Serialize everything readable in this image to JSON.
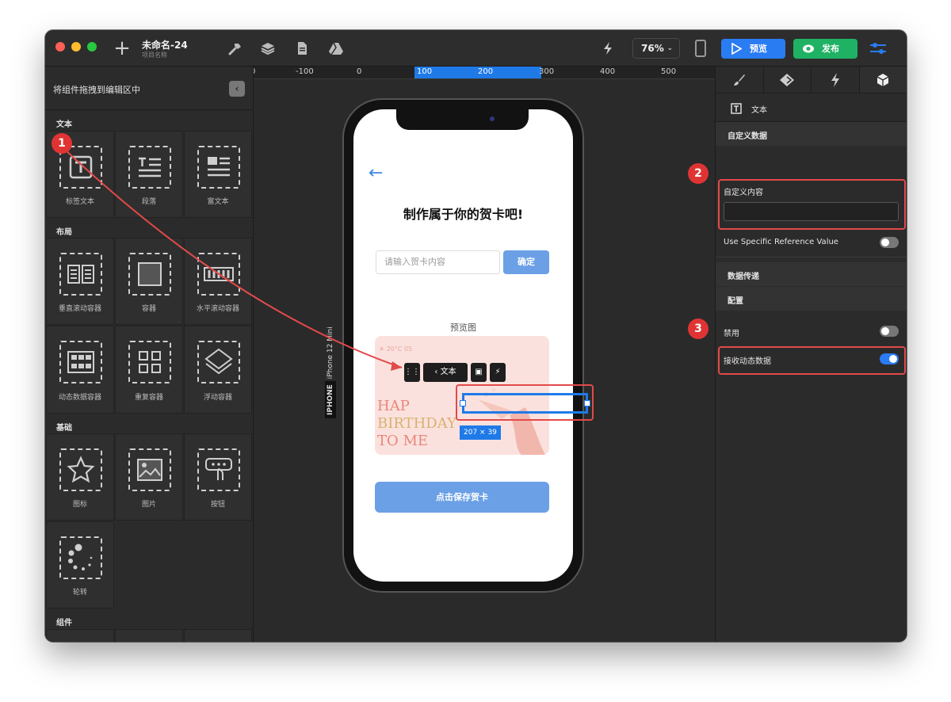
{
  "app": {
    "doc_title": "未命名-24",
    "doc_subtitle": "项目名称",
    "zoom": "76%",
    "preview_label": "预览",
    "publish_label": "发布"
  },
  "left_panel": {
    "header": "将组件拖拽到编辑区中",
    "sections": {
      "text": "文本",
      "layout": "布局",
      "basic": "基础",
      "components": "组件"
    },
    "text_items": [
      "标签文本",
      "段落",
      "富文本"
    ],
    "layout_items": [
      "垂直滚动容器",
      "容器",
      "水平滚动容器",
      "动态数据容器",
      "重复容器",
      "浮动容器"
    ],
    "basic_items": [
      "图标",
      "图片",
      "按钮",
      "轮转"
    ]
  },
  "canvas": {
    "ruler_labels": [
      "0",
      "-100",
      "0",
      "100",
      "200",
      "300",
      "400",
      "500"
    ],
    "device_name": "IPHONE",
    "device_model": "iPhone 12 Mini",
    "screen": {
      "heading": "制作属于你的贺卡吧!",
      "input_placeholder": "请输入贺卡内容",
      "confirm_label": "确定",
      "preview_label": "预览图",
      "card_weather": "20°C 05",
      "card_line1": "HAP",
      "card_line2": "BIRTHDAY",
      "card_line3": "TO ME",
      "save_label": "点击保存贺卡"
    },
    "element_toolbar": {
      "text_label": "文本"
    },
    "selection_size": "207 × 39",
    "badges": [
      "1",
      "2",
      "3"
    ]
  },
  "right_panel": {
    "component_name": "文本",
    "custom_data_section": "自定义数据",
    "custom_content_label": "自定义内容",
    "custom_content_value": "",
    "use_ref_label": "Use Specific Reference Value",
    "data_transfer_section": "数据传递",
    "config_section": "配置",
    "disable_label": "禁用",
    "receive_dynamic_label": "接收动态数据",
    "receive_dynamic_on": true
  },
  "colors": {
    "accent_blue": "#2a7cf3",
    "publish_green": "#1fb264",
    "annotation_red": "#e24a4a"
  }
}
